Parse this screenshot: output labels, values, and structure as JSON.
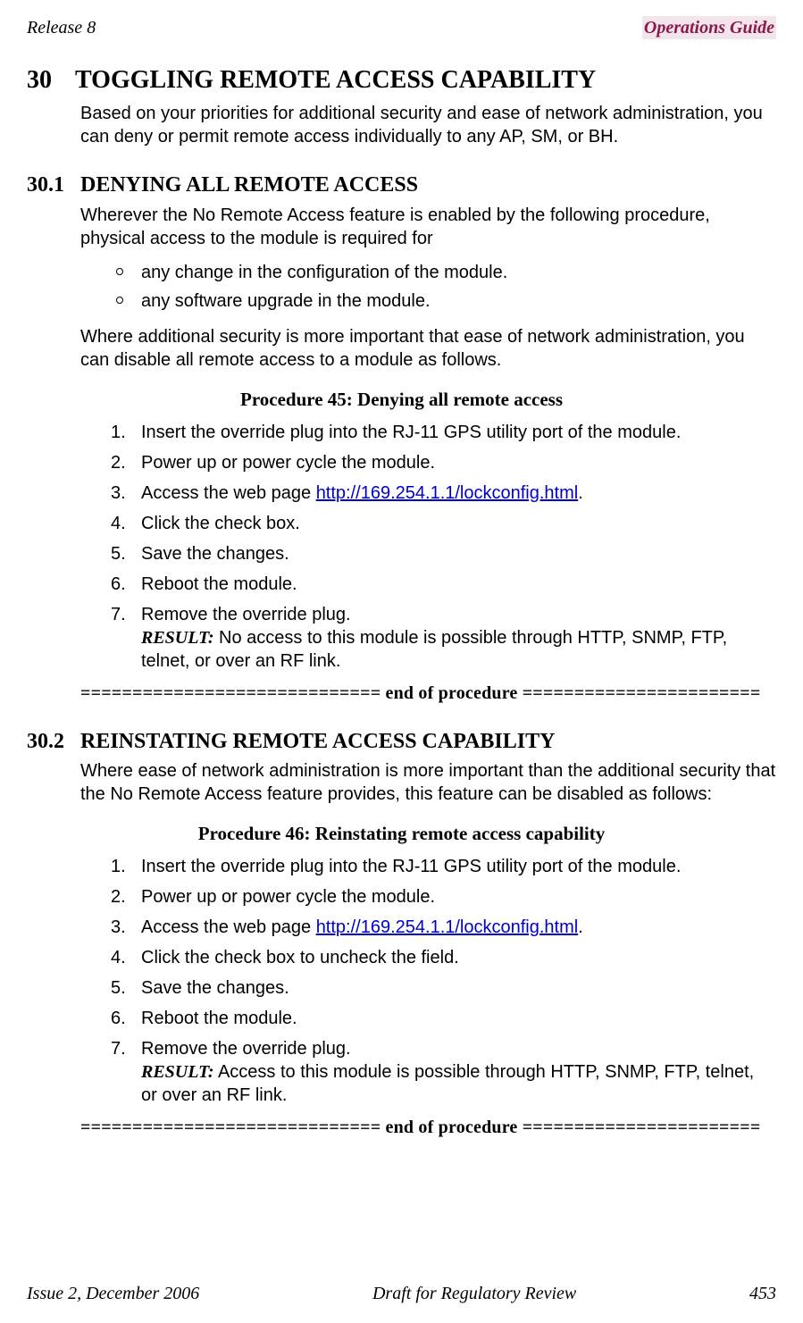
{
  "header": {
    "left": "Release 8",
    "right": "Operations Guide"
  },
  "footer": {
    "left": "Issue 2, December 2006",
    "center": "Draft for Regulatory Review",
    "right": "453"
  },
  "chapter": {
    "num": "30",
    "title": "TOGGLING REMOTE ACCESS CAPABILITY"
  },
  "intro": "Based on your priorities for additional security and ease of network administration, you can deny or permit remote access individually to any AP, SM, or BH.",
  "sec1": {
    "num": "30.1",
    "title": "DENYING ALL REMOTE ACCESS",
    "para1": "Wherever the No Remote Access feature is enabled by the following procedure, physical access to the module is required for",
    "bullets": [
      "any change in the configuration of the module.",
      "any software upgrade in the module."
    ],
    "para2": "Where additional security is more important that ease of network administration, you can disable all remote access to a module as follows.",
    "proc_title": "Procedure 45: Denying all remote access",
    "steps": [
      {
        "n": "1.",
        "t": "Insert the override plug into the RJ-11 GPS utility port of the module."
      },
      {
        "n": "2.",
        "t": "Power up or power cycle the module."
      },
      {
        "n": "3.",
        "pre": "Access the web page ",
        "link": "http://169.254.1.1/lockconfig.html",
        "post": "."
      },
      {
        "n": "4.",
        "t": "Click the check box."
      },
      {
        "n": "5.",
        "t": "Save the changes."
      },
      {
        "n": "6.",
        "t": "Reboot the module."
      },
      {
        "n": "7.",
        "t": "Remove the override plug.",
        "result": " No access to this module is possible through HTTP, SNMP, FTP, telnet, or over an RF link."
      }
    ],
    "end": "============================= end of procedure ======================="
  },
  "sec2": {
    "num": "30.2",
    "title": "REINSTATING REMOTE ACCESS CAPABILITY",
    "para1": "Where ease of network administration is more important than the additional security that the No Remote Access feature provides, this feature can be disabled as follows:",
    "proc_title": "Procedure 46: Reinstating remote access capability",
    "steps": [
      {
        "n": "1.",
        "t": "Insert the override plug into the RJ-11 GPS utility port of the module."
      },
      {
        "n": "2.",
        "t": "Power up or power cycle the module."
      },
      {
        "n": "3.",
        "pre": "Access the web page ",
        "link": "http://169.254.1.1/lockconfig.html",
        "post": "."
      },
      {
        "n": "4.",
        "t": "Click the check box to uncheck the field."
      },
      {
        "n": "5.",
        "t": "Save the changes."
      },
      {
        "n": "6.",
        "t": "Reboot the module."
      },
      {
        "n": "7.",
        "t": "Remove the override plug.",
        "result": " Access to this module is possible through HTTP, SNMP, FTP, telnet, or over an RF link."
      }
    ],
    "end": "============================= end of procedure ======================="
  },
  "labels": {
    "result": "RESULT:"
  }
}
